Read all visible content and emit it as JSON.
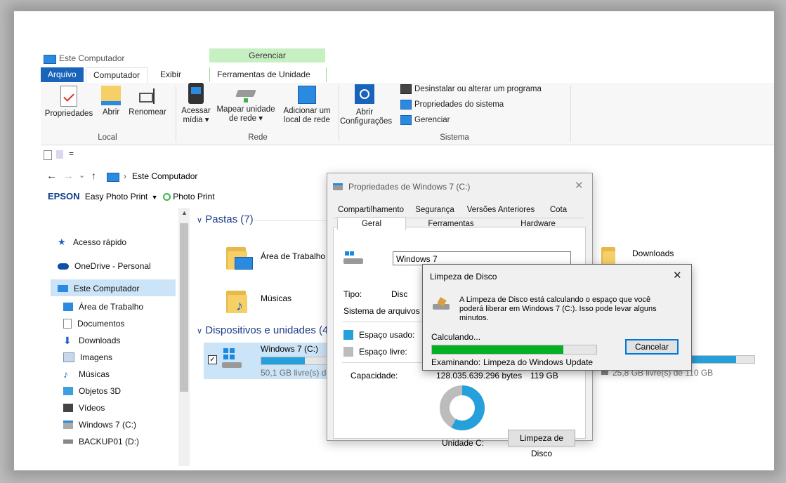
{
  "window": {
    "title": "Este Computador",
    "context_tab_group": "Gerenciar",
    "tabs": [
      "Arquivo",
      "Computador",
      "Exibir",
      "Ferramentas de Unidade"
    ]
  },
  "ribbon": {
    "local": {
      "label": "Local",
      "buttons": [
        "Propriedades",
        "Abrir",
        "Renomear"
      ]
    },
    "rede": {
      "label": "Rede",
      "buttons": [
        {
          "line1": "Acessar",
          "line2": "mídia ▾"
        },
        {
          "line1": "Mapear unidade",
          "line2": "de rede ▾"
        },
        {
          "line1": "Adicionar um",
          "line2": "local de rede"
        }
      ]
    },
    "sistema": {
      "label": "Sistema",
      "open_line1": "Abrir",
      "open_line2": "Configurações",
      "items": [
        "Desinstalar ou alterar um programa",
        "Propriedades do sistema",
        "Gerenciar"
      ]
    }
  },
  "qat": {
    "dropdown": "="
  },
  "nav": {
    "crumb": "Este Computador"
  },
  "epson": {
    "brand": "EPSON",
    "app1": "Easy Photo Print",
    "app2": "Photo Print"
  },
  "sidebar": {
    "items": [
      "Acesso rápido",
      "OneDrive - Personal",
      "Este Computador",
      "Área de Trabalho",
      "Documentos",
      "Downloads",
      "Imagens",
      "Músicas",
      "Objetos 3D",
      "Vídeos",
      "Windows 7 (C:)",
      "BACKUP01 (D:)"
    ]
  },
  "content": {
    "folders_header": "Pastas (7)",
    "folders": [
      "Área de Trabalho",
      "Músicas",
      "Downloads"
    ],
    "devices_header": "Dispositivos e unidades (4)",
    "drive_c": {
      "name": "Windows 7 (C:)",
      "free": "50,1 GB livre(s) de 11",
      "fill": 0.58
    },
    "drive_other": {
      "free": "25,8 GB livre(s) de 110 GB",
      "fill": 0.77
    }
  },
  "properties": {
    "title": "Propriedades de Windows 7 (C:)",
    "tabs_row1": [
      "Compartilhamento",
      "Segurança",
      "Versões Anteriores",
      "Cota"
    ],
    "tabs_row2": [
      "Geral",
      "Ferramentas",
      "Hardware"
    ],
    "name_value": "Windows 7",
    "tipo_label": "Tipo:",
    "tipo_value": "Disc",
    "fs_label": "Sistema de arquivos",
    "used_label": "Espaço usado:",
    "free_label": "Espaço livre:",
    "capacity_label": "Capacidade:",
    "capacity_bytes": "128.035.639.296 bytes",
    "capacity_gb": "119 GB",
    "drive_label": "Unidade C:",
    "cleanup_button": "Limpeza de Disco",
    "used_fraction": 0.58,
    "colors": {
      "used": "#26a0da",
      "free": "#bcbcbc"
    }
  },
  "cleanup": {
    "title": "Limpeza de Disco",
    "message": "A Limpeza de Disco está calculando o espaço que você poderá liberar em Windows 7 (C:). Isso pode levar alguns minutos.",
    "status": "Calculando...",
    "progress": 0.8,
    "cancel": "Cancelar",
    "scanning_label": "Examinando:",
    "scanning_value": "Limpeza do Windows Update"
  }
}
